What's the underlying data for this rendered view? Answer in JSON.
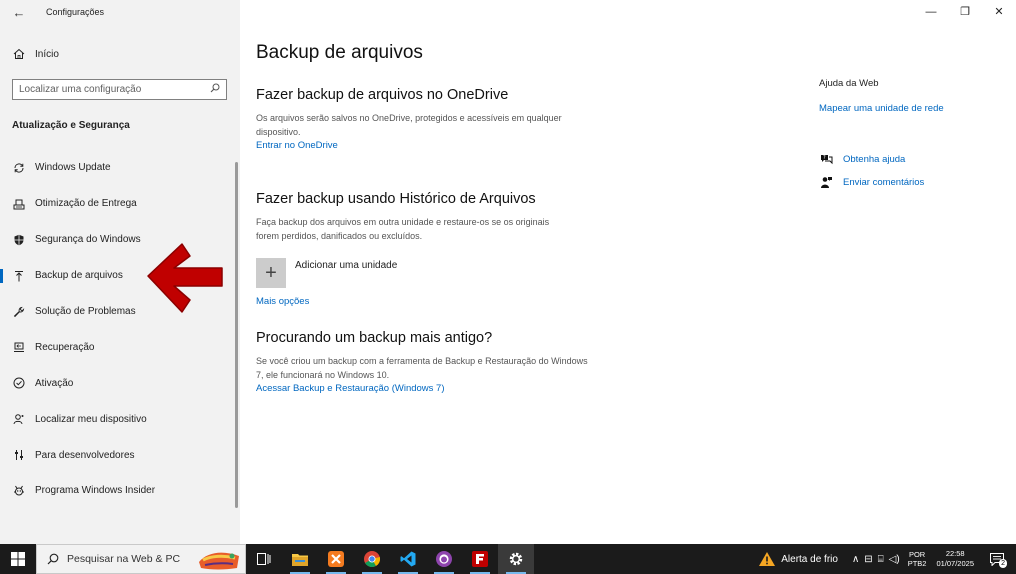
{
  "window": {
    "app_title": "Configurações",
    "back_label": "←",
    "minimize": "—",
    "maximize": "❐",
    "close": "✕"
  },
  "sidebar": {
    "home_label": "Início",
    "search_placeholder": "Localizar uma configuração",
    "section_title": "Atualização e Segurança",
    "items": [
      {
        "label": "Windows Update",
        "icon": "refresh-icon"
      },
      {
        "label": "Otimização de Entrega",
        "icon": "delivery-icon"
      },
      {
        "label": "Segurança do Windows",
        "icon": "shield-icon"
      },
      {
        "label": "Backup de arquivos",
        "icon": "backup-upload-icon",
        "active": true
      },
      {
        "label": "Solução de Problemas",
        "icon": "wrench-icon"
      },
      {
        "label": "Recuperação",
        "icon": "recovery-icon"
      },
      {
        "label": "Ativação",
        "icon": "check-circle-icon"
      },
      {
        "label": "Localizar meu dispositivo",
        "icon": "person-locate-icon"
      },
      {
        "label": "Para desenvolvedores",
        "icon": "developer-icon"
      },
      {
        "label": "Programa Windows Insider",
        "icon": "insider-icon"
      }
    ]
  },
  "main": {
    "title": "Backup de arquivos",
    "onedrive": {
      "heading": "Fazer backup de arquivos no OneDrive",
      "description": "Os arquivos serão salvos no OneDrive, protegidos e acessíveis em qualquer dispositivo.",
      "link": "Entrar no OneDrive"
    },
    "history": {
      "heading": "Fazer backup usando Histórico de Arquivos",
      "description": "Faça backup dos arquivos em outra unidade e restaure-os se os originais forem perdidos, danificados ou excluídos.",
      "add_drive": "Adicionar uma unidade",
      "more_options": "Mais opções"
    },
    "older": {
      "heading": "Procurando um backup mais antigo?",
      "description": "Se você criou um backup com a ferramenta de Backup e Restauração do Windows 7, ele funcionará no Windows 10.",
      "link": "Acessar Backup e Restauração (Windows 7)"
    }
  },
  "right_panel": {
    "title": "Ajuda da Web",
    "map_link": "Mapear uma unidade de rede",
    "help_link": "Obtenha ajuda",
    "feedback_link": "Enviar comentários"
  },
  "taskbar": {
    "search_placeholder": "Pesquisar na Web & PC",
    "apps": [
      "task-view-icon",
      "file-explorer-icon",
      "xampp-icon",
      "chrome-icon",
      "vscode-icon",
      "github-icon",
      "filezilla-icon",
      "settings-icon"
    ],
    "weather": "Alerta de frio",
    "lang_top": "POR",
    "lang_bottom": "PTB2",
    "time": "22:58",
    "date": "01/07/2025",
    "notification_count": "2"
  },
  "colors": {
    "accent": "#0067c0",
    "sidebar_bg": "#f2f2f2",
    "taskbar_bg": "#1b1b1b",
    "annotation_arrow": "#c00000"
  }
}
